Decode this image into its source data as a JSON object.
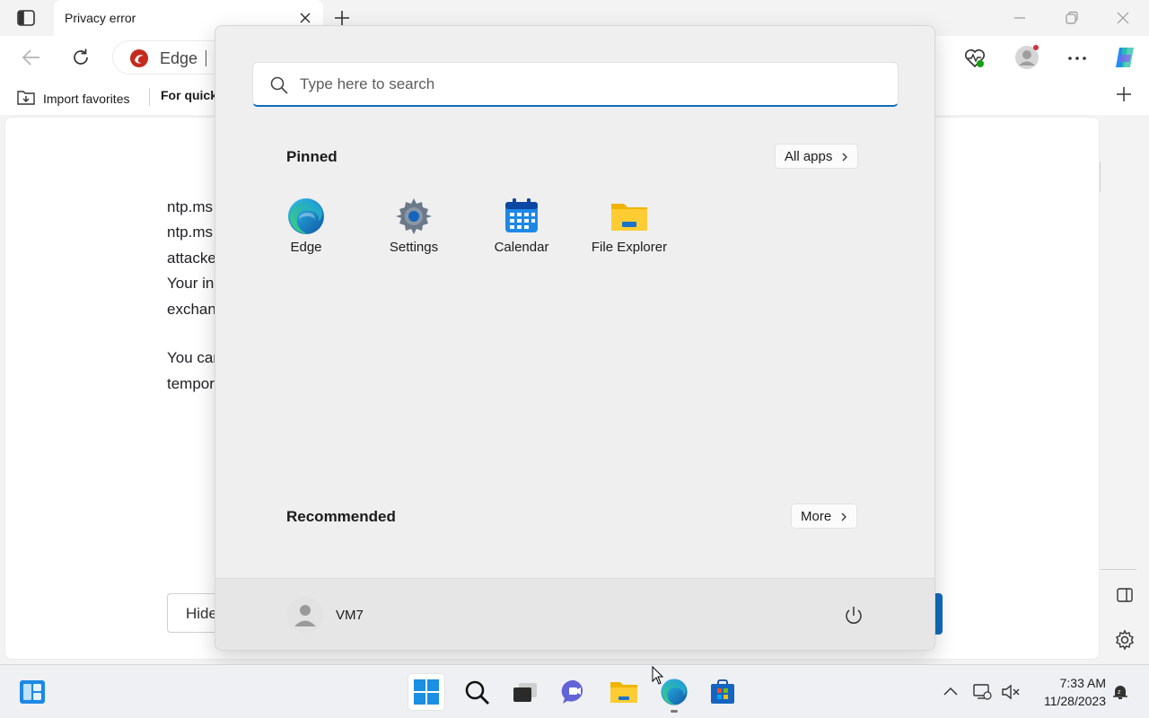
{
  "browser": {
    "tab_title": "Privacy error",
    "address_text": "Edge",
    "favorites": {
      "import_label": "Import favorites",
      "quick_label": "For quick"
    }
  },
  "page": {
    "lines": [
      "ntp.ms",
      "ntp.ms",
      "attacke",
      "Your in",
      "exchan",
      "You car",
      "tempor"
    ],
    "hide_button": "Hide"
  },
  "start_menu": {
    "search_placeholder": "Type here to search",
    "pinned_title": "Pinned",
    "all_apps_label": "All apps",
    "pinned_apps": [
      {
        "label": "Edge",
        "icon": "edge-icon"
      },
      {
        "label": "Settings",
        "icon": "settings-gear-icon"
      },
      {
        "label": "Calendar",
        "icon": "calendar-icon"
      },
      {
        "label": "File Explorer",
        "icon": "folder-icon"
      }
    ],
    "recommended_title": "Recommended",
    "more_label": "More",
    "user_name": "VM7"
  },
  "taskbar": {
    "time": "7:33 AM",
    "date": "11/28/2023"
  },
  "colors": {
    "accent": "#0f6cbd",
    "start_bg": "#efefef",
    "taskbar_bg": "#eef0f3"
  }
}
